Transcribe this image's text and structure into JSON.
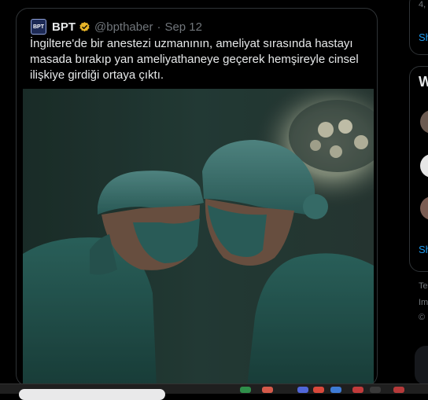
{
  "tweet": {
    "avatar_text": "BPT",
    "display_name": "BPT",
    "handle": "@bpthaber",
    "separator": "·",
    "date": "Sep 12",
    "text": "İngiltere'de bir anestezi uzmanının, ameliyat sırasında hastayı masada bırakıp yan ameliyathaneye geçerek hemşireyle cinsel ilişkiye girdiği ortaya çıktı."
  },
  "right_sidebar": {
    "top_number": "4,",
    "show_more_1": "Sh",
    "section_title": "W",
    "show_more_2": "Sh",
    "footer_1": "Te",
    "footer_2": "Im",
    "footer_3": "©"
  },
  "colors": {
    "accent": "#1d9bf0",
    "verified": "#e8b427",
    "scrub": "#3b7a78"
  },
  "icons": [
    "verified-badge-icon",
    "search-icon",
    "taskbar-app-icon"
  ]
}
